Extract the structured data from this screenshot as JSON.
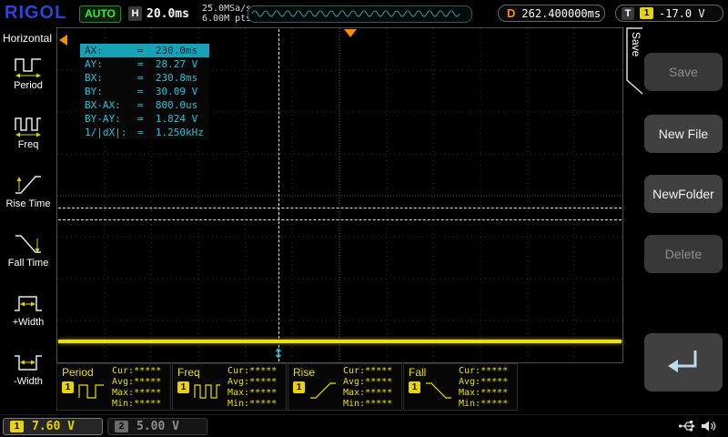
{
  "top_bar": {
    "logo": "RIGOL",
    "run_status": "AUTO",
    "horizontal_label": "H",
    "timebase": "20.0ms",
    "sample_rate": "25.0MSa/s",
    "memory_depth": "6.00M pts",
    "delay_label": "D",
    "delay_value": "262.400000ms",
    "trigger_label": "T",
    "trigger_channel": "1",
    "trigger_level": "-17.0 V"
  },
  "left_panel": {
    "title": "Horizontal",
    "items": [
      {
        "label": "Period",
        "icon": "period-icon"
      },
      {
        "label": "Freq",
        "icon": "freq-icon"
      },
      {
        "label": "Rise Time",
        "icon": "rise-time-icon"
      },
      {
        "label": "Fall Time",
        "icon": "fall-time-icon"
      },
      {
        "label": "+Width",
        "icon": "plus-width-icon"
      },
      {
        "label": "-Width",
        "icon": "minus-width-icon"
      }
    ]
  },
  "cursor_panel": {
    "rows": [
      {
        "name": "AX:",
        "value": "=  230.0ms"
      },
      {
        "name": "AY:",
        "value": "=  28.27 V"
      },
      {
        "name": "BX:",
        "value": "=  230.8ms"
      },
      {
        "name": "BY:",
        "value": "=  30.09 V"
      },
      {
        "name": "BX-AX:",
        "value": "=  800.0us"
      },
      {
        "name": "BY-AY:",
        "value": "=  1.824 V"
      },
      {
        "name": "1/|dX|:",
        "value": "=  1.250kHz"
      }
    ]
  },
  "measurements": [
    {
      "label": "Period",
      "channel": "1",
      "cur": "Cur:*****",
      "avg": "Avg:*****",
      "max": "Max:*****",
      "min": "Min:*****"
    },
    {
      "label": "Freq",
      "channel": "1",
      "cur": "Cur:*****",
      "avg": "Avg:*****",
      "max": "Max:*****",
      "min": "Min:*****"
    },
    {
      "label": "Rise",
      "channel": "1",
      "cur": "Cur:*****",
      "avg": "Avg:*****",
      "max": "Max:*****",
      "min": "Min:*****"
    },
    {
      "label": "Fall",
      "channel": "1",
      "cur": "Cur:*****",
      "avg": "Avg:*****",
      "max": "Max:*****",
      "min": "Min:*****"
    }
  ],
  "channel_bar": {
    "ch1_number": "1",
    "ch1_scale": "7.60 V",
    "ch2_number": "2",
    "ch2_scale": "5.00 V"
  },
  "menu": {
    "tab_label": "Save",
    "buttons": [
      {
        "label": "Save",
        "enabled": false
      },
      {
        "label": "New File",
        "enabled": true
      },
      {
        "label": "NewFolder",
        "enabled": true
      },
      {
        "label": "Delete",
        "enabled": false
      }
    ],
    "back_button_icon": "return-arrow-icon"
  },
  "status_icons": {
    "usb": "usb-icon",
    "beeper": "speaker-icon"
  },
  "colors": {
    "channel1_yellow": "#e8d400",
    "channel2_gray": "#8f8f8f",
    "cursor_cyan": "#25c3d8",
    "delay_orange": "#ff8c00",
    "logo_blue": "#2a46d4",
    "auto_green": "#35e935"
  }
}
